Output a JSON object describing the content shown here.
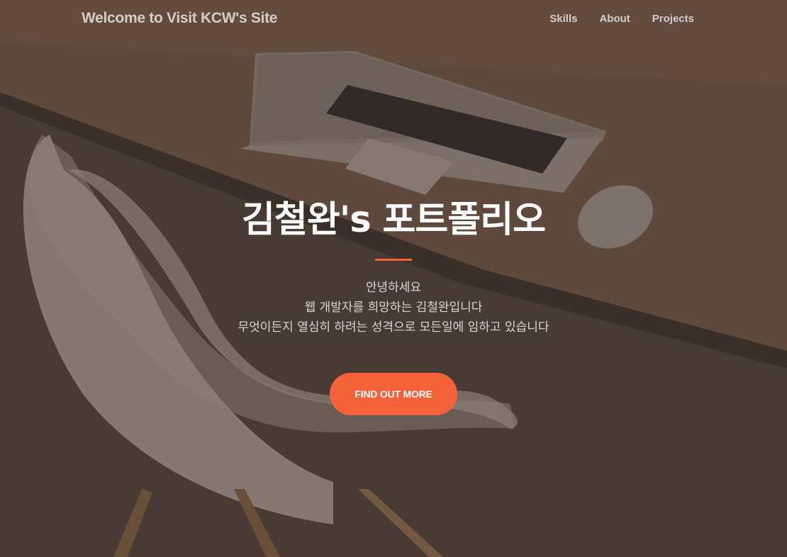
{
  "navbar": {
    "brand": "Welcome to Visit KCW's Site",
    "links": [
      {
        "label": "Skills"
      },
      {
        "label": "About"
      },
      {
        "label": "Projects"
      }
    ]
  },
  "masthead": {
    "title": "김철완's 포트폴리오",
    "intro_lines": [
      "안녕하세요",
      "웹 개발자를 희망하는 김철완입니다",
      "무엇이든지 열심히 하려는 성격으로 모든일에 임하고 있습니다"
    ],
    "cta_label": "FIND OUT MORE"
  },
  "colors": {
    "accent": "#f4623a",
    "overlay": "#4a3f37",
    "text": "#ffffff"
  }
}
